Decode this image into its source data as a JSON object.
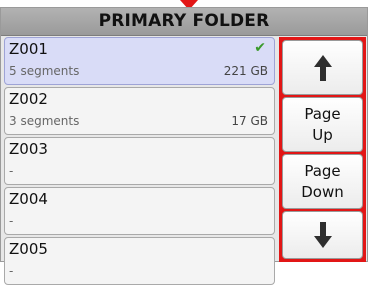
{
  "header": {
    "title": "PRIMARY FOLDER"
  },
  "zones": [
    {
      "name": "Z001",
      "detail": "5 segments",
      "size": "221 GB",
      "check": "✔"
    },
    {
      "name": "Z002",
      "detail": "3 segments",
      "size": "17 GB"
    },
    {
      "name": "Z003",
      "detail": "-"
    },
    {
      "name": "Z004",
      "detail": "-"
    },
    {
      "name": "Z005",
      "detail": "-"
    }
  ],
  "nav": {
    "up_icon": "up-arrow",
    "page_up_label": "Page\nUp",
    "page_down_label": "Page\nDown",
    "down_icon": "down-arrow"
  },
  "colors": {
    "highlight": "#e21616",
    "selected_row": "#d9dcf7",
    "check": "#3a9a2b"
  }
}
